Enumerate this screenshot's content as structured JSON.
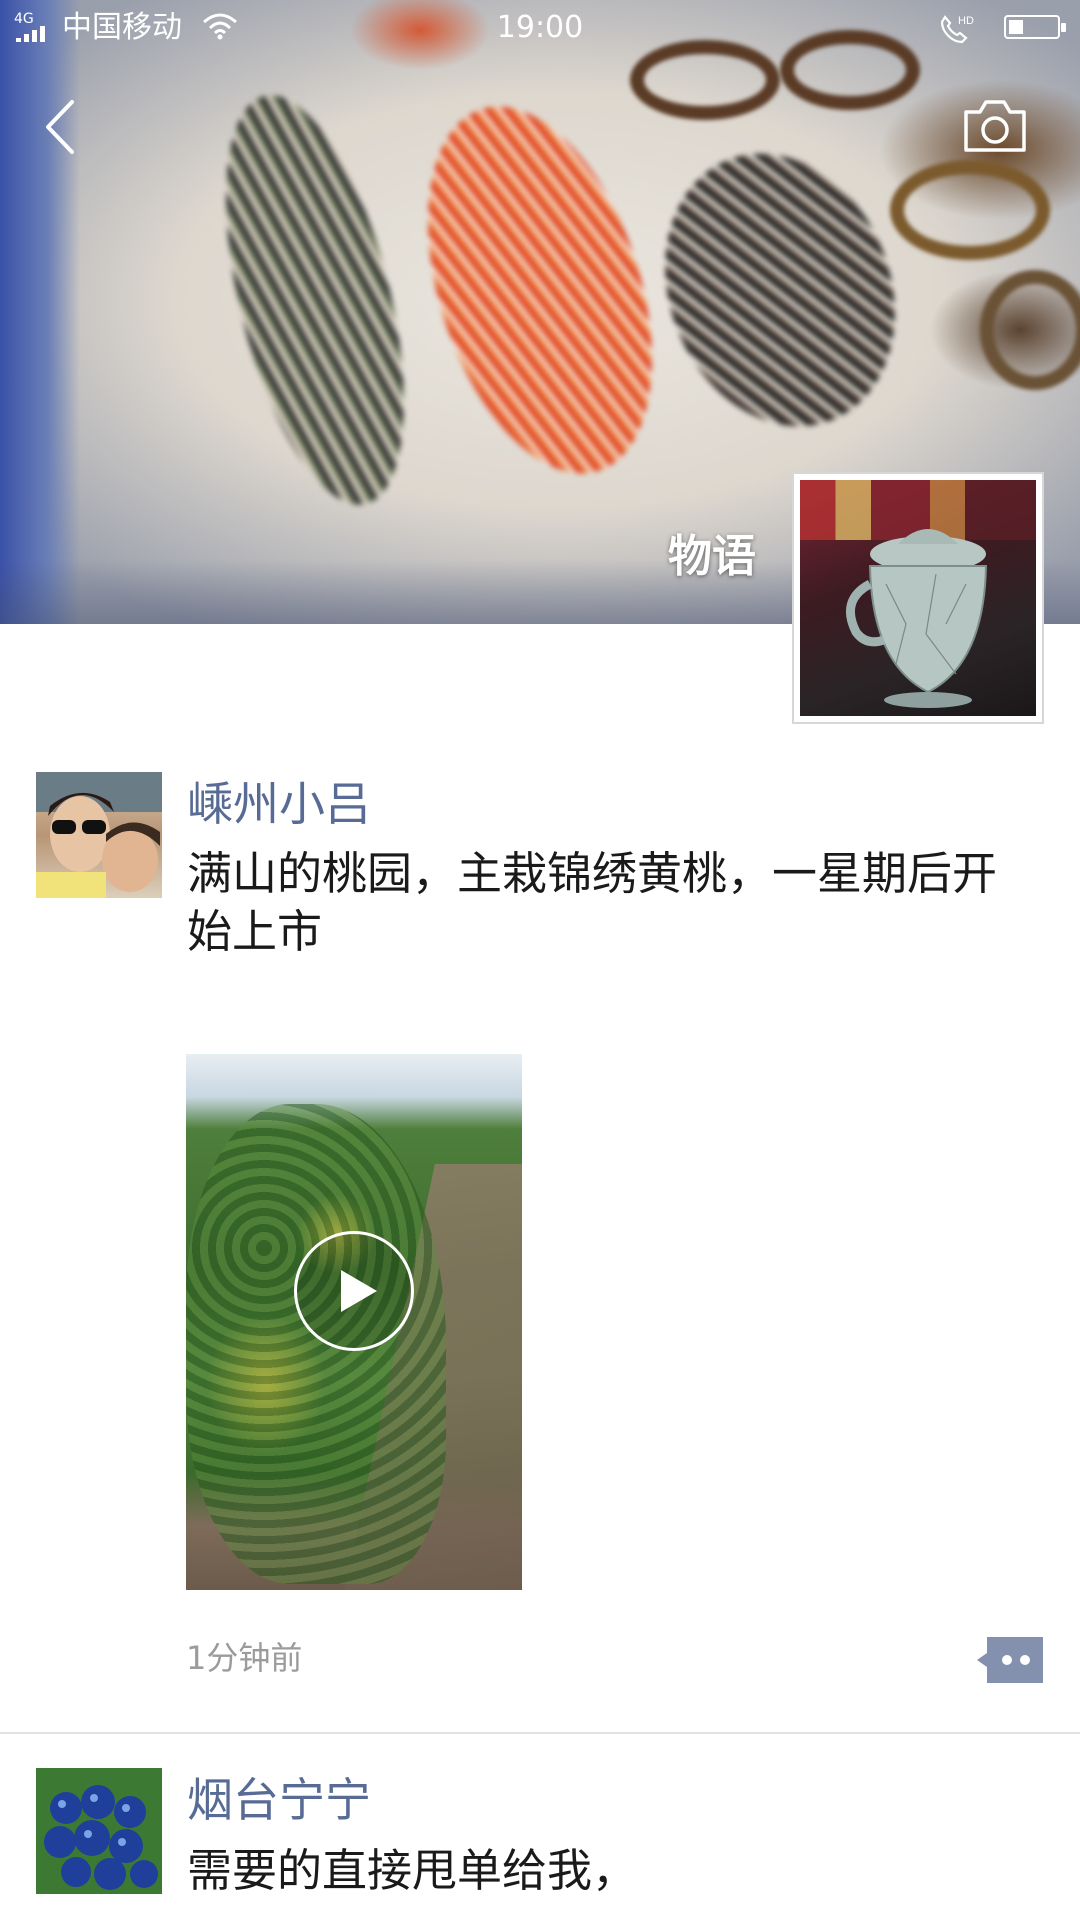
{
  "status_bar": {
    "network_type": "4G",
    "carrier": "中国移动",
    "time": "19:00",
    "hd_label": "HD",
    "battery_level_fraction": 0.3
  },
  "header": {
    "back_icon": "chevron-left-icon",
    "camera_icon": "camera-icon",
    "cover_owner_name": "物语"
  },
  "posts": [
    {
      "user_name": "嵊州小吕",
      "text": "满山的桃园，主栽锦绣黄桃，一星期后开始上市",
      "media_type": "video",
      "timestamp": "1分钟前",
      "comment_icon": "comment-dots-icon"
    },
    {
      "user_name": "烟台宁宁",
      "text": "需要的直接甩单给我，"
    }
  ],
  "colors": {
    "name_link": "#576b95",
    "body_text": "#1a1a1a",
    "timestamp": "#9b9b9b",
    "comment_button": "#8390ae"
  }
}
